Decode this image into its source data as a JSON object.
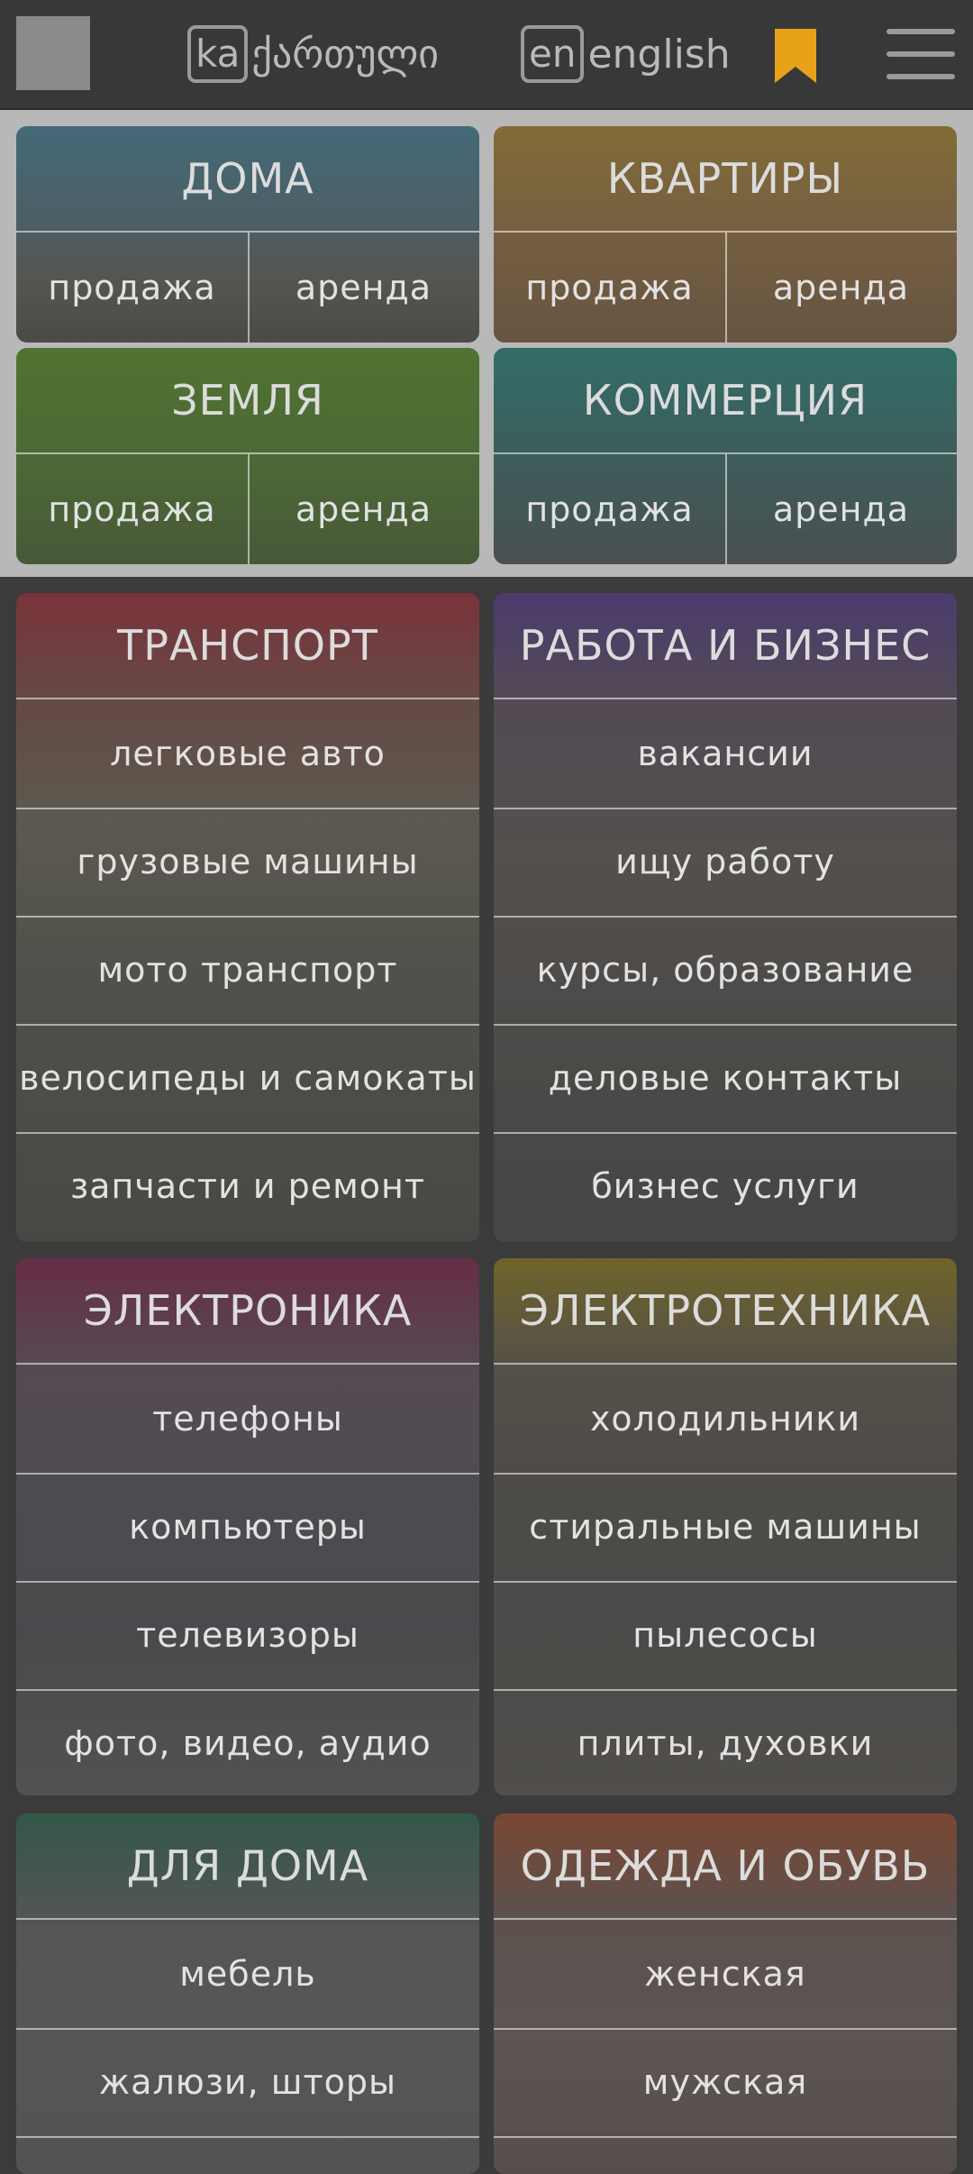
{
  "header": {
    "lang_ka_code": "ka",
    "lang_ka_label": "ქართული",
    "lang_en_code": "en",
    "lang_en_label": "english",
    "accent_color": "#e8a21a"
  },
  "realty": [
    {
      "id": "houses",
      "title": "ДОМА",
      "sale": "продажа",
      "rent": "аренда",
      "color": "#3a8fa8"
    },
    {
      "id": "apartments",
      "title": "КВАРТИРЫ",
      "sale": "продажа",
      "rent": "аренда",
      "color": "#b88a2e"
    },
    {
      "id": "land",
      "title": "ЗЕМЛЯ",
      "sale": "продажа",
      "rent": "аренда",
      "color": "#5b8f2a"
    },
    {
      "id": "commercial",
      "title": "КОММЕРЦИЯ",
      "sale": "продажа",
      "rent": "аренда",
      "color": "#2c8a80"
    }
  ],
  "categories": [
    {
      "id": "transport",
      "title": "ТРАНСПОРТ",
      "color": "#b0303e",
      "items": [
        "легковые авто",
        "грузовые машины",
        "мото транспорт",
        "велосипеды и самокаты",
        "запчасти и ремонт"
      ]
    },
    {
      "id": "work",
      "title": "РАБОТА И БИЗНЕС",
      "color": "#5b3f9c",
      "items": [
        "вакансии",
        "ищу работу",
        "курсы, образование",
        "деловые контакты",
        "бизнес услуги"
      ]
    },
    {
      "id": "electronics",
      "title": "ЭЛЕКТРОНИКА",
      "color": "#8e2454",
      "items": [
        "телефоны",
        "компьютеры",
        "телевизоры",
        "фото, видео, аудио"
      ]
    },
    {
      "id": "appliances",
      "title": "ЭЛЕКТРОТЕХНИКА",
      "color": "#9c8a1e",
      "items": [
        "холодильники",
        "стиральные машины",
        "пылесосы",
        "плиты, духовки"
      ]
    },
    {
      "id": "home",
      "title": "ДЛЯ ДОМА",
      "color": "#2e7356",
      "items": [
        "мебель",
        "жалюзи, шторы"
      ]
    },
    {
      "id": "clothes",
      "title": "ОДЕЖДА И ОБУВЬ",
      "color": "#b0542e",
      "items": [
        "женская",
        "мужская"
      ]
    }
  ]
}
